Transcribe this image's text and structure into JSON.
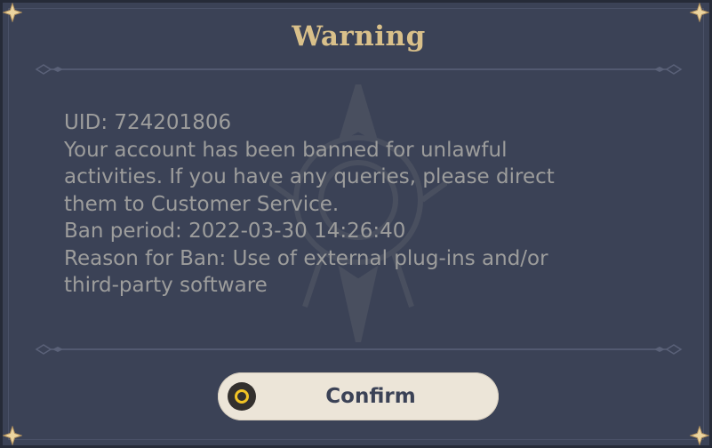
{
  "dialog": {
    "title": "Warning",
    "message_lines": [
      "UID: 724201806",
      "Your account has been banned for unlawful",
      "activities. If you have any queries, please direct",
      "them to Customer Service.",
      "Ban period: 2022-03-30 14:26:40",
      "Reason for Ban: Use of external plug-ins and/or",
      "third-party software"
    ],
    "confirm_label": "Confirm"
  },
  "colors": {
    "panel_background": "#3b4256",
    "title_gold": "#d9c08a",
    "message_text": "#9d9d9c",
    "button_background": "#ece5d8",
    "button_icon_ring": "#f2c425"
  },
  "icons": {
    "corner": "four-point-star-icon",
    "confirm": "circle-button-icon",
    "watermark": "emblem-watermark"
  }
}
